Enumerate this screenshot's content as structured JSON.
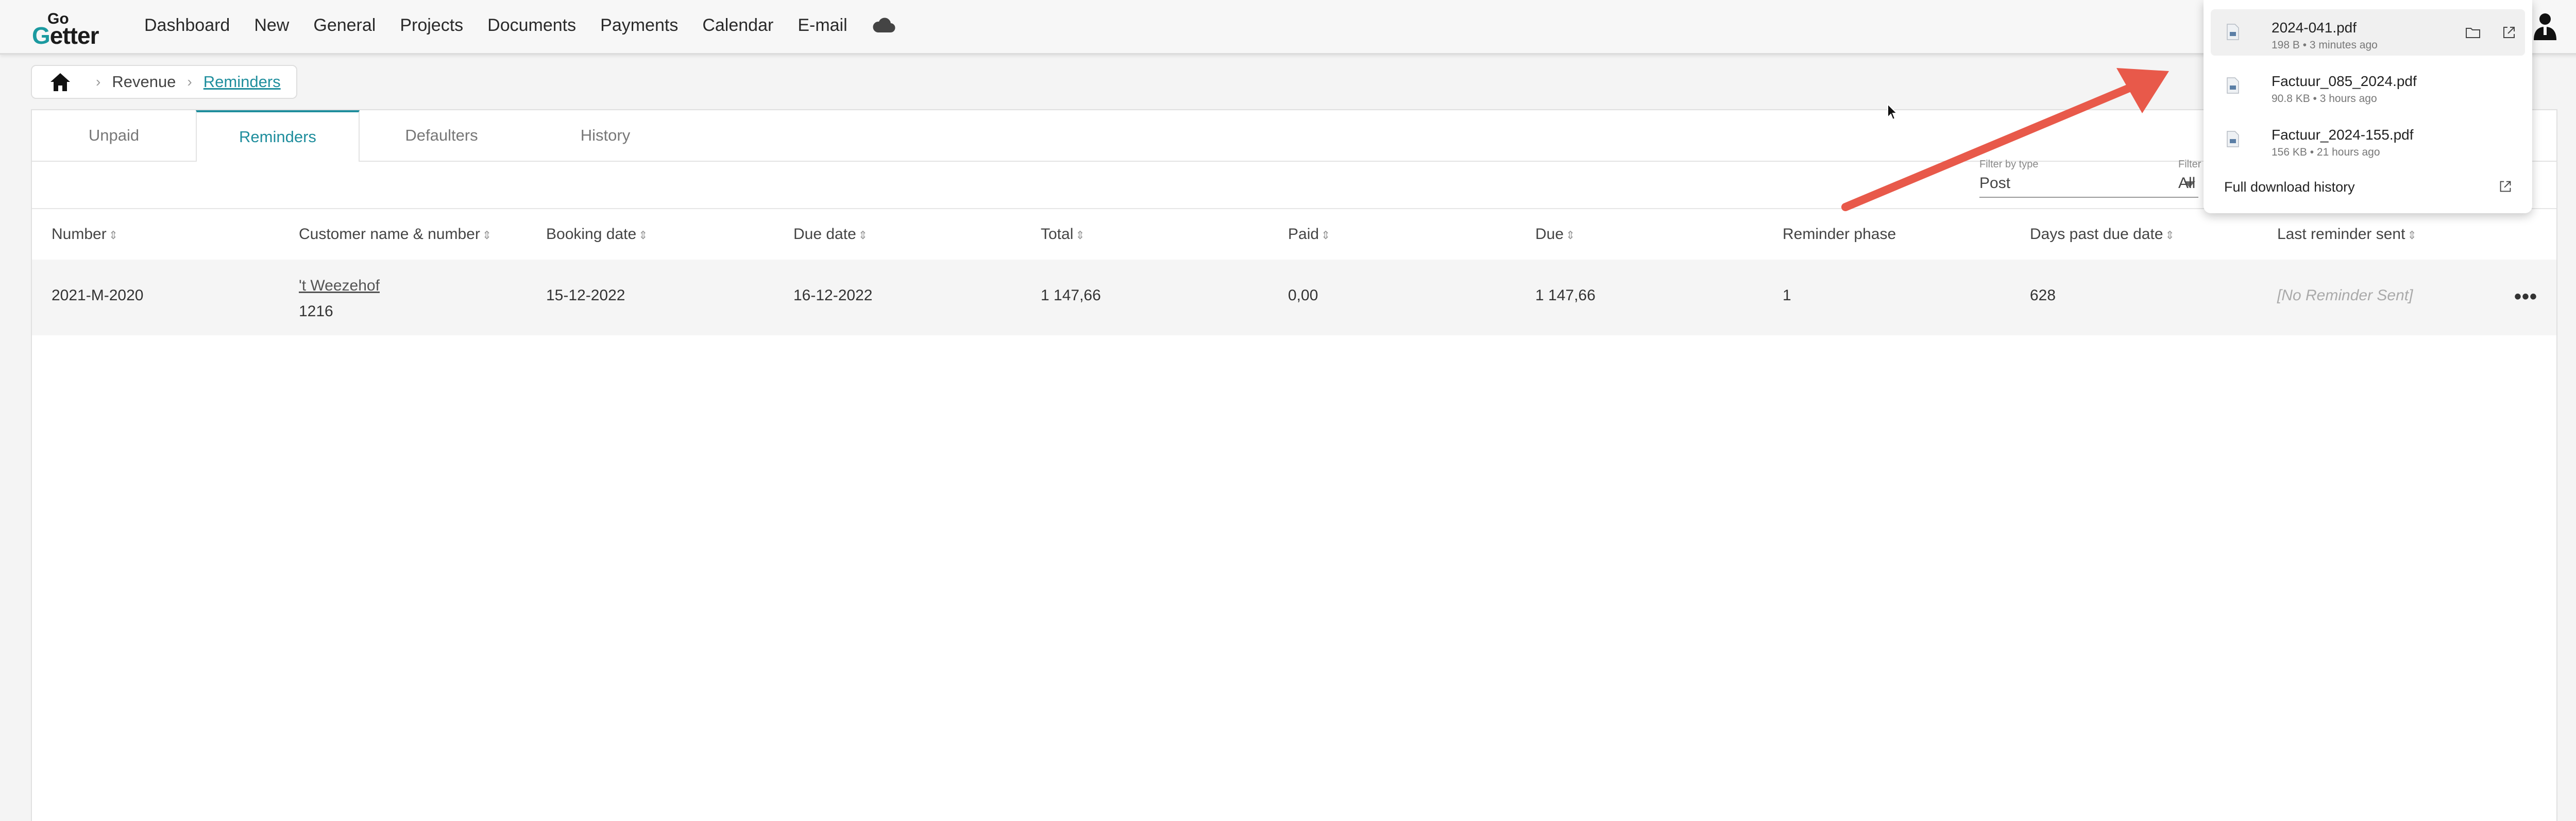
{
  "app": {
    "logo_top": "Go",
    "logo_main_g": "G",
    "logo_main_rest": "etter"
  },
  "nav": {
    "items": [
      "Dashboard",
      "New",
      "General",
      "Projects",
      "Documents",
      "Payments",
      "Calendar",
      "E-mail"
    ],
    "cloud_icon": "cloud-icon"
  },
  "breadcrumb": {
    "items": [
      "Revenue",
      "Reminders"
    ]
  },
  "tabs": [
    "Unpaid",
    "Reminders",
    "Defaulters",
    "History"
  ],
  "active_tab": "Reminders",
  "filters": {
    "type_label": "Filter by type",
    "type_value": "Post",
    "second_label": "Filter",
    "second_value": "All"
  },
  "table": {
    "headers": [
      "Number",
      "Customer name & number",
      "Booking date",
      "Due date",
      "Total",
      "Paid",
      "Due",
      "Reminder phase",
      "Days past due date",
      "Last reminder sent"
    ],
    "rows": [
      {
        "number": "2021-M-2020",
        "customer_name": "'t Weezehof",
        "customer_number": "1216",
        "booking_date": "15-12-2022",
        "due_date": "16-12-2022",
        "total": "1 147,66",
        "paid": "0,00",
        "due": "1 147,66",
        "reminder_phase": "1",
        "days_past_due": "628",
        "last_reminder_sent": "[No Reminder Sent]"
      }
    ],
    "row_menu": "•••"
  },
  "downloads": {
    "items": [
      {
        "name": "2024-041.pdf",
        "meta": "198 B • 3 minutes ago"
      },
      {
        "name": "Factuur_085_2024.pdf",
        "meta": "90.8 KB • 3 hours ago"
      },
      {
        "name": "Factuur_2024-155.pdf",
        "meta": "156 KB • 21 hours ago"
      }
    ],
    "full_history": "Full download history"
  },
  "colors": {
    "accent": "#1f8e9d",
    "arrow": "#e8594a"
  }
}
